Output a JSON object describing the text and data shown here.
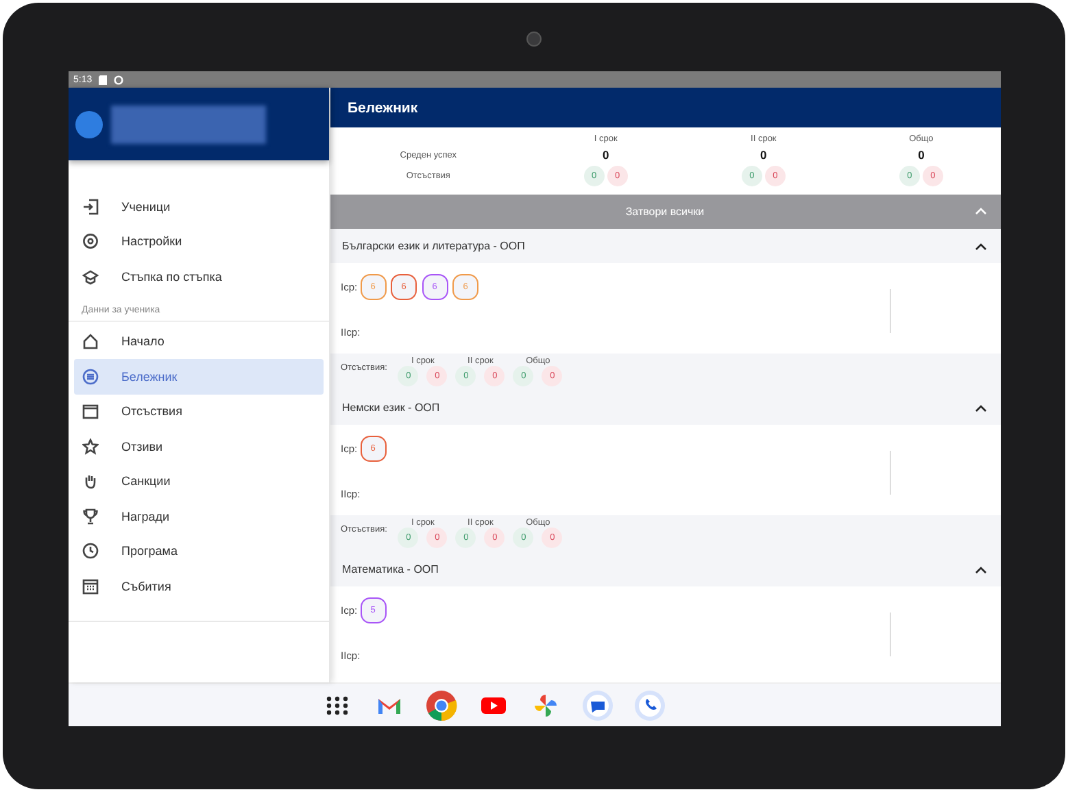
{
  "status_bar": {
    "time": "5:13"
  },
  "sidebar": {
    "items": [
      {
        "label": "Ученици",
        "kind": "login",
        "selected": false
      },
      {
        "label": "Настройки",
        "kind": "gear",
        "selected": false
      },
      {
        "label": "Стъпка по стъпка",
        "kind": "cap",
        "selected": false
      }
    ],
    "section_label": "Данни за ученика",
    "student_items": [
      {
        "label": "Начало",
        "kind": "home",
        "selected": false
      },
      {
        "label": "Бележник",
        "kind": "list",
        "selected": true
      },
      {
        "label": "Отсъствия",
        "kind": "calendar",
        "selected": false
      },
      {
        "label": "Отзиви",
        "kind": "star",
        "selected": false
      },
      {
        "label": "Санкции",
        "kind": "hand",
        "selected": false
      },
      {
        "label": "Награди",
        "kind": "trophy",
        "selected": false
      },
      {
        "label": "Програма",
        "kind": "clock",
        "selected": false
      },
      {
        "label": "Събития",
        "kind": "grid",
        "selected": false
      }
    ]
  },
  "app_bar": {
    "title": "Бележник"
  },
  "summary": {
    "columns": [
      "I срок",
      "II срок",
      "Общо"
    ],
    "average_label": "Среден успех",
    "averages": [
      "0",
      "0",
      "0"
    ],
    "absences_label": "Отсъствия",
    "absences": [
      [
        {
          "value": "0",
          "kind": "excused"
        },
        {
          "value": "0",
          "kind": "unexcused"
        }
      ],
      [
        {
          "value": "0",
          "kind": "excused"
        },
        {
          "value": "0",
          "kind": "unexcused"
        }
      ],
      [
        {
          "value": "0",
          "kind": "excused"
        },
        {
          "value": "0",
          "kind": "unexcused"
        }
      ]
    ]
  },
  "close_all": {
    "label": "Затвори всички",
    "expanded": true
  },
  "subjects": [
    {
      "title": "Български език и литература - ООП",
      "expanded": true,
      "term1_label": "Iср:",
      "term2_label": "IIср:",
      "grades": [
        {
          "value": "6",
          "color": "#f09a4a"
        },
        {
          "value": "6",
          "color": "#e8603c"
        },
        {
          "value": "6",
          "color": "#a855f7"
        },
        {
          "value": "6",
          "color": "#f09a4a"
        }
      ],
      "absences_label": "Отсъствия:",
      "absence_columns": [
        "I срок",
        "II срок",
        "Общо"
      ],
      "absences": [
        {
          "value": "0",
          "kind": "excused"
        },
        {
          "value": "0",
          "kind": "unexcused"
        },
        {
          "value": "0",
          "kind": "excused"
        },
        {
          "value": "0",
          "kind": "unexcused"
        },
        {
          "value": "0",
          "kind": "excused"
        },
        {
          "value": "0",
          "kind": "unexcused"
        }
      ]
    },
    {
      "title": "Немски език - ООП",
      "expanded": true,
      "term1_label": "Iср:",
      "term2_label": "IIср:",
      "grades": [
        {
          "value": "6",
          "color": "#e8603c"
        }
      ],
      "absences_label": "Отсъствия:",
      "absence_columns": [
        "I срок",
        "II срок",
        "Общо"
      ],
      "absences": [
        {
          "value": "0",
          "kind": "excused"
        },
        {
          "value": "0",
          "kind": "unexcused"
        },
        {
          "value": "0",
          "kind": "excused"
        },
        {
          "value": "0",
          "kind": "unexcused"
        },
        {
          "value": "0",
          "kind": "excused"
        },
        {
          "value": "0",
          "kind": "unexcused"
        }
      ]
    },
    {
      "title": "Математика - ООП",
      "expanded": true,
      "term1_label": "Iср:",
      "term2_label": "IIср:",
      "grades": [
        {
          "value": "5",
          "color": "#a855f7"
        }
      ]
    }
  ]
}
